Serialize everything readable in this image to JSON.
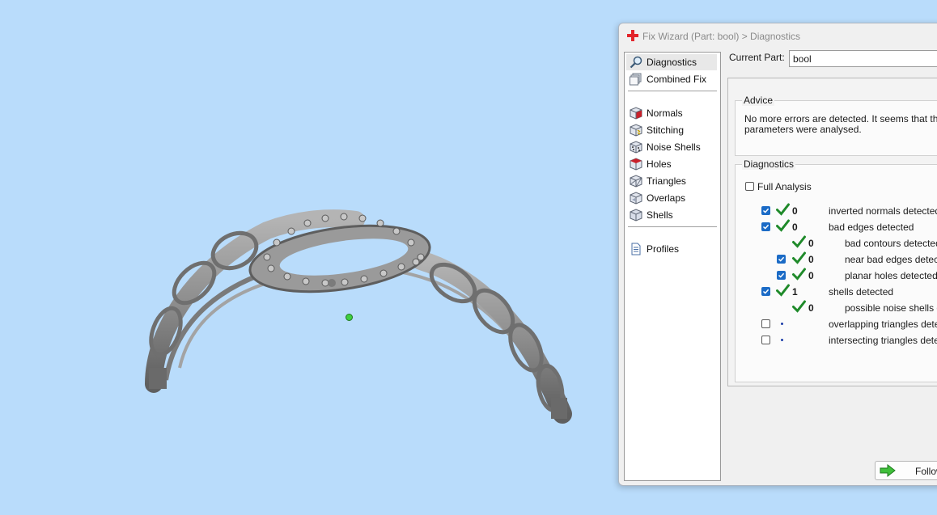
{
  "window": {
    "title": "Fix Wizard (Part: bool) > Diagnostics"
  },
  "nav": {
    "items": [
      {
        "label": "Diagnostics",
        "icon": "magnifier-icon",
        "selected": true
      },
      {
        "label": "Combined Fix",
        "icon": "combined-fix-icon"
      },
      {
        "label": "Normals",
        "icon": "normals-cube-icon"
      },
      {
        "label": "Stitching",
        "icon": "stitching-cube-icon"
      },
      {
        "label": "Noise Shells",
        "icon": "noise-shells-cube-icon"
      },
      {
        "label": "Holes",
        "icon": "holes-cube-icon"
      },
      {
        "label": "Triangles",
        "icon": "triangles-cube-icon"
      },
      {
        "label": "Overlaps",
        "icon": "overlaps-cube-icon"
      },
      {
        "label": "Shells",
        "icon": "shells-cube-icon"
      },
      {
        "label": "Profiles",
        "icon": "document-icon"
      }
    ]
  },
  "current_part": {
    "label": "Current Part:",
    "value": "bool"
  },
  "advice": {
    "title": "Advice",
    "line1": "No more errors are detected. It seems that the",
    "line2": "parameters were analysed."
  },
  "diagnostics": {
    "title": "Diagnostics",
    "full_analysis_label": "Full Analysis",
    "full_analysis_checked": false,
    "rows": [
      {
        "checkbox": true,
        "checked": true,
        "status": "ok",
        "count": "0",
        "label": "inverted normals detected"
      },
      {
        "checkbox": true,
        "checked": true,
        "status": "ok",
        "count": "0",
        "label": "bad edges detected"
      },
      {
        "checkbox": false,
        "status": "ok",
        "count": "0",
        "label": "bad contours detected"
      },
      {
        "checkbox": true,
        "checked": true,
        "status": "ok",
        "count": "0",
        "label": "near bad edges detected"
      },
      {
        "checkbox": true,
        "checked": true,
        "status": "ok",
        "count": "0",
        "label": "planar holes detected"
      },
      {
        "checkbox": true,
        "checked": true,
        "status": "ok",
        "count": "1",
        "label": "shells detected"
      },
      {
        "checkbox": false,
        "status": "ok",
        "count": "0",
        "label": "possible noise shells detected"
      },
      {
        "checkbox": true,
        "checked": false,
        "status": "pending",
        "count": "",
        "label": "overlapping triangles detected"
      },
      {
        "checkbox": true,
        "checked": false,
        "status": "pending",
        "count": "",
        "label": "intersecting triangles detected"
      }
    ]
  },
  "follow_button": {
    "label": "Follow",
    "icon": "green-arrow-right-icon"
  },
  "colors": {
    "background": "#b9dcfb",
    "check_green": "#1f8a2a",
    "checkbox_blue": "#1b6bc6",
    "model_grey": "#8d8d8d"
  }
}
